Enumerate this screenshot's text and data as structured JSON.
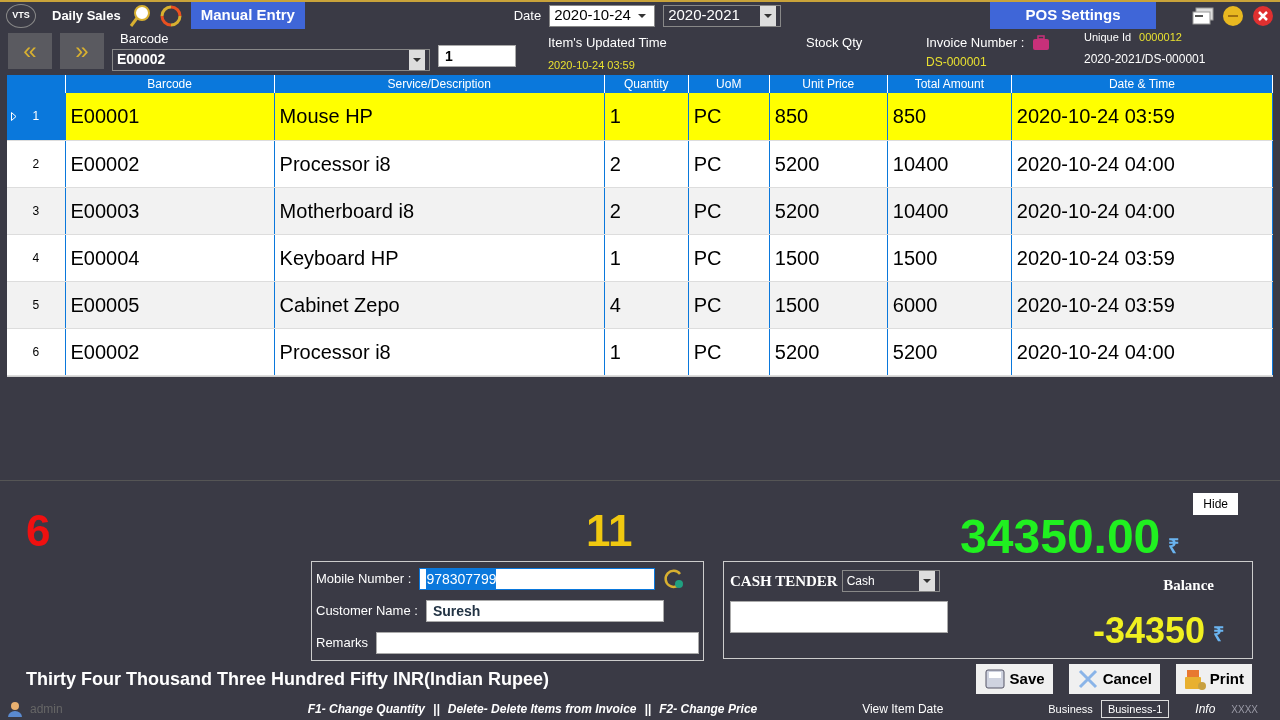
{
  "header": {
    "logo": "VTS",
    "previous": "«",
    "next": "»",
    "title": "Daily Sales",
    "manual_entry": "Manual Entry",
    "date_label": "Date",
    "date": "2020-10-24",
    "year": "2020-2021",
    "pos_settings": "POS Settings"
  },
  "entry": {
    "barcode_label": "Barcode",
    "barcode": "E00002",
    "quantity": "1",
    "updated_time_label": "Item's Updated Time",
    "updated_time": "2020-10-24 03:59",
    "stock_qty_label": "Stock Qty",
    "invoice_number_label": "Invoice Number :",
    "invoice_number": "DS-000001",
    "unique_id_label": "Unique Id",
    "unique_id": "0000012",
    "invoice_path": "2020-2021/DS-000001"
  },
  "table": {
    "columns": [
      "",
      "Barcode",
      "Service/Description",
      "Quantity",
      "UoM",
      "Unit Price",
      "Total Amount",
      "Date & Time"
    ],
    "rows": [
      {
        "selected": true,
        "cells": [
          "1",
          "E00001",
          "Mouse HP",
          "1",
          "PC",
          "850",
          "850",
          "2020-10-24 03:59"
        ]
      },
      {
        "selected": false,
        "cells": [
          "2",
          "E00002",
          "Processor i8",
          "2",
          "PC",
          "5200",
          "10400",
          "2020-10-24 04:00"
        ]
      },
      {
        "selected": false,
        "cells": [
          "3",
          "E00003",
          "Motherboard i8",
          "2",
          "PC",
          "5200",
          "10400",
          "2020-10-24 04:00"
        ]
      },
      {
        "selected": false,
        "cells": [
          "4",
          "E00004",
          "Keyboard HP",
          "1",
          "PC",
          "1500",
          "1500",
          "2020-10-24 03:59"
        ]
      },
      {
        "selected": false,
        "cells": [
          "5",
          "E00005",
          "Cabinet Zepo",
          "4",
          "PC",
          "1500",
          "6000",
          "2020-10-24 03:59"
        ]
      },
      {
        "selected": false,
        "cells": [
          "6",
          "E00002",
          "Processor i8",
          "1",
          "PC",
          "5200",
          "5200",
          "2020-10-24 04:00"
        ]
      }
    ]
  },
  "summary": {
    "item_count": "6",
    "total_quantity": "11",
    "hide": "Hide",
    "total": "34350.00",
    "total_currency": "₹"
  },
  "customer": {
    "mobile_label": "Mobile Number :",
    "mobile": "978307799",
    "name_label": "Customer Name :",
    "name": "Suresh",
    "remarks_label": "Remarks"
  },
  "tender": {
    "label": "CASH TENDER",
    "mode": "Cash",
    "balance_label": "Balance",
    "balance": "-34350",
    "balance_currency": "₹"
  },
  "amount_words": "Thirty Four Thousand Three Hundred Fifty INR(Indian Rupee)",
  "buttons": [
    {
      "kind": "save",
      "label": "Save"
    },
    {
      "kind": "cancel",
      "label": "Cancel"
    },
    {
      "kind": "print",
      "label": "Print"
    }
  ],
  "status_bar": {
    "user": "admin",
    "shortcuts": [
      "F1- Change Quantity",
      "||",
      "Delete- Delete Items from Invoice",
      "||",
      "F2- Change Price"
    ],
    "view_item_date": "View Item Date",
    "business_label": "Business",
    "business": "Business-1",
    "info": "Info",
    "code": "XXXX"
  }
}
